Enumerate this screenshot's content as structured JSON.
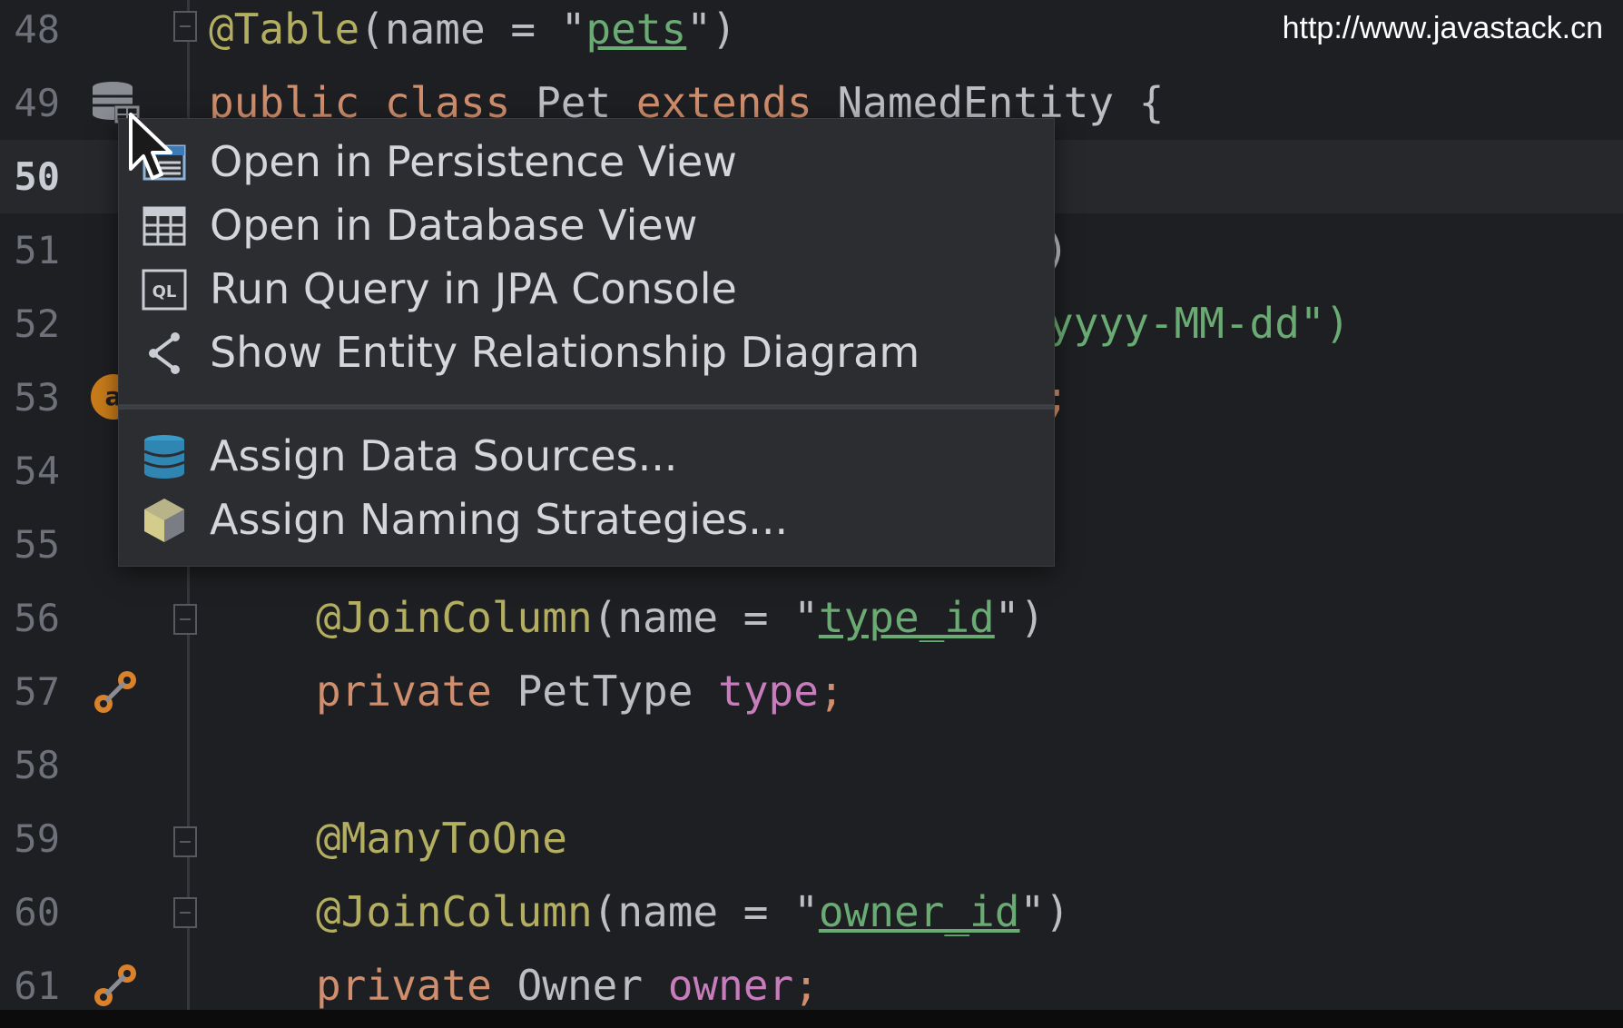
{
  "watermark": "http://www.javastack.cn",
  "editor": {
    "current_line": "50",
    "lines": [
      {
        "num": "48"
      },
      {
        "num": "49"
      },
      {
        "num": "50"
      },
      {
        "num": "51"
      },
      {
        "num": "52"
      },
      {
        "num": "53"
      },
      {
        "num": "54"
      },
      {
        "num": "55"
      },
      {
        "num": "56"
      },
      {
        "num": "57"
      },
      {
        "num": "58"
      },
      {
        "num": "59"
      },
      {
        "num": "60"
      },
      {
        "num": "61"
      }
    ],
    "code": {
      "l48": {
        "annotation": "@Table",
        "open": "(name = \"",
        "value": "pets",
        "close": "\")"
      },
      "l49": {
        "kw1": "public",
        "kw2": "class",
        "name": "Pet",
        "kw3": "extends",
        "parent": "NamedEntity",
        "brace": "{"
      },
      "l51_tail": ")",
      "l52_tail": "yyyy-MM-dd\")",
      "l53_tail": ";",
      "l56": {
        "annotation": "@JoinColumn",
        "open": "(name = \"",
        "value": "type_id",
        "close": "\")"
      },
      "l57": {
        "kw": "private",
        "type": "PetType",
        "field": "type",
        "semi": ";"
      },
      "l59": {
        "annotation": "@ManyToOne"
      },
      "l60": {
        "annotation": "@JoinColumn",
        "open": "(name = \"",
        "value": "owner_id",
        "close": "\")"
      },
      "l61": {
        "kw": "private",
        "type": "Owner",
        "field": "owner",
        "semi": ";"
      }
    },
    "gutter_avatar_letter": "a"
  },
  "popup_menu": {
    "items": [
      {
        "label": "Open in Persistence View",
        "icon": "persistence-view-icon"
      },
      {
        "label": "Open in Database View",
        "icon": "table-grid-icon"
      },
      {
        "label": "Run Query in JPA Console",
        "icon": "ql-console-icon"
      },
      {
        "label": "Show Entity Relationship Diagram",
        "icon": "diagram-icon"
      }
    ],
    "items2": [
      {
        "label": "Assign Data Sources...",
        "icon": "database-icon"
      },
      {
        "label": "Assign Naming Strategies...",
        "icon": "naming-strategy-icon"
      }
    ]
  },
  "colors": {
    "background": "#1e1f22",
    "keyword": "#cf8e6d",
    "annotation": "#b3ae60",
    "string": "#6aab73",
    "field": "#c77dbb",
    "popup_bg": "#2b2d30"
  }
}
